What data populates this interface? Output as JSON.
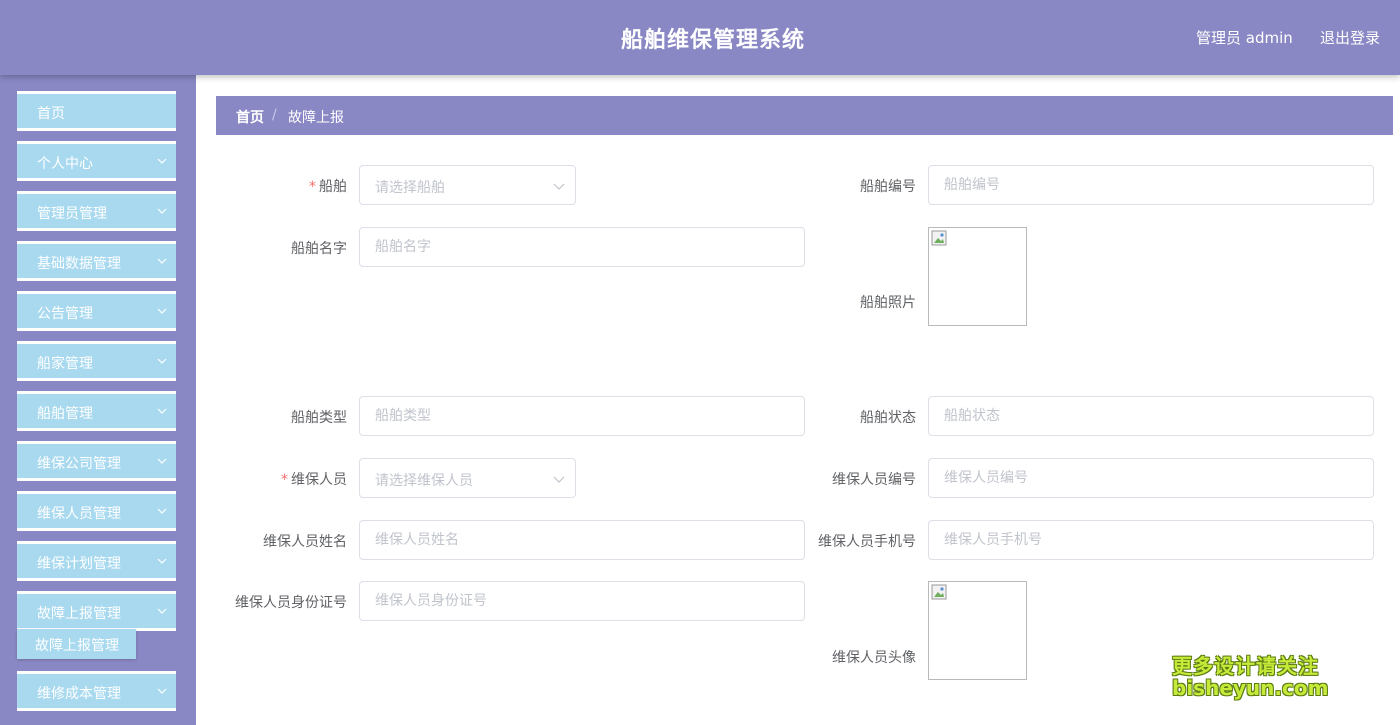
{
  "header": {
    "title": "船舶维保管理系统",
    "user": "管理员 admin",
    "logout": "退出登录"
  },
  "sidebar": {
    "items": [
      {
        "label": "首页",
        "has_children": false
      },
      {
        "label": "个人中心",
        "has_children": true
      },
      {
        "label": "管理员管理",
        "has_children": true
      },
      {
        "label": "基础数据管理",
        "has_children": true
      },
      {
        "label": "公告管理",
        "has_children": true
      },
      {
        "label": "船家管理",
        "has_children": true
      },
      {
        "label": "船舶管理",
        "has_children": true
      },
      {
        "label": "维保公司管理",
        "has_children": true
      },
      {
        "label": "维保人员管理",
        "has_children": true
      },
      {
        "label": "维保计划管理",
        "has_children": true
      },
      {
        "label": "故障上报管理",
        "has_children": true,
        "expanded": true
      },
      {
        "label": "维修成本管理",
        "has_children": true
      }
    ],
    "subitem": "故障上报管理"
  },
  "breadcrumb": {
    "home": "首页",
    "separator": "/",
    "current": "故障上报"
  },
  "form": {
    "ship": {
      "label": "船舶",
      "required": true,
      "placeholder": "请选择船舶"
    },
    "ship_no": {
      "label": "船舶编号",
      "placeholder": "船舶编号"
    },
    "ship_name": {
      "label": "船舶名字",
      "placeholder": "船舶名字"
    },
    "ship_photo": {
      "label": "船舶照片"
    },
    "ship_type": {
      "label": "船舶类型",
      "placeholder": "船舶类型"
    },
    "ship_status": {
      "label": "船舶状态",
      "placeholder": "船舶状态"
    },
    "staff": {
      "label": "维保人员",
      "required": true,
      "placeholder": "请选择维保人员"
    },
    "staff_no": {
      "label": "维保人员编号",
      "placeholder": "维保人员编号"
    },
    "staff_name": {
      "label": "维保人员姓名",
      "placeholder": "维保人员姓名"
    },
    "staff_phone": {
      "label": "维保人员手机号",
      "placeholder": "维保人员手机号"
    },
    "staff_id": {
      "label": "维保人员身份证号",
      "placeholder": "维保人员身份证号"
    },
    "staff_avatar": {
      "label": "维保人员头像"
    }
  },
  "watermark": {
    "line1": "更多设计请关注",
    "line2": "bisheyun.com"
  },
  "colors": {
    "primary": "#8a88c4",
    "menu_item": "#a8d9ef",
    "required": "#f56c6c"
  }
}
